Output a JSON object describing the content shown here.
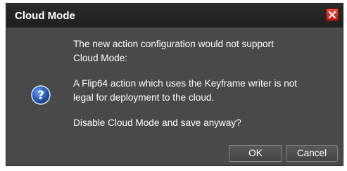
{
  "dialog": {
    "title": "Cloud Mode",
    "icon": "question-icon",
    "message_lines_1": [
      "The new action configuration would not support",
      "Cloud Mode:"
    ],
    "message_lines_2": [
      "A Flip64 action which uses the Keyframe writer is not",
      "legal for deployment to the cloud."
    ],
    "message_lines_3": [
      "Disable Cloud Mode and save anyway?"
    ],
    "ok_label": "OK",
    "cancel_label": "Cancel"
  },
  "colors": {
    "dialog_background": "#494949",
    "titlebar_background": "#232323",
    "close_button": "#d0281a",
    "icon_blue": "#2b5fb8",
    "text": "#ffffff"
  }
}
